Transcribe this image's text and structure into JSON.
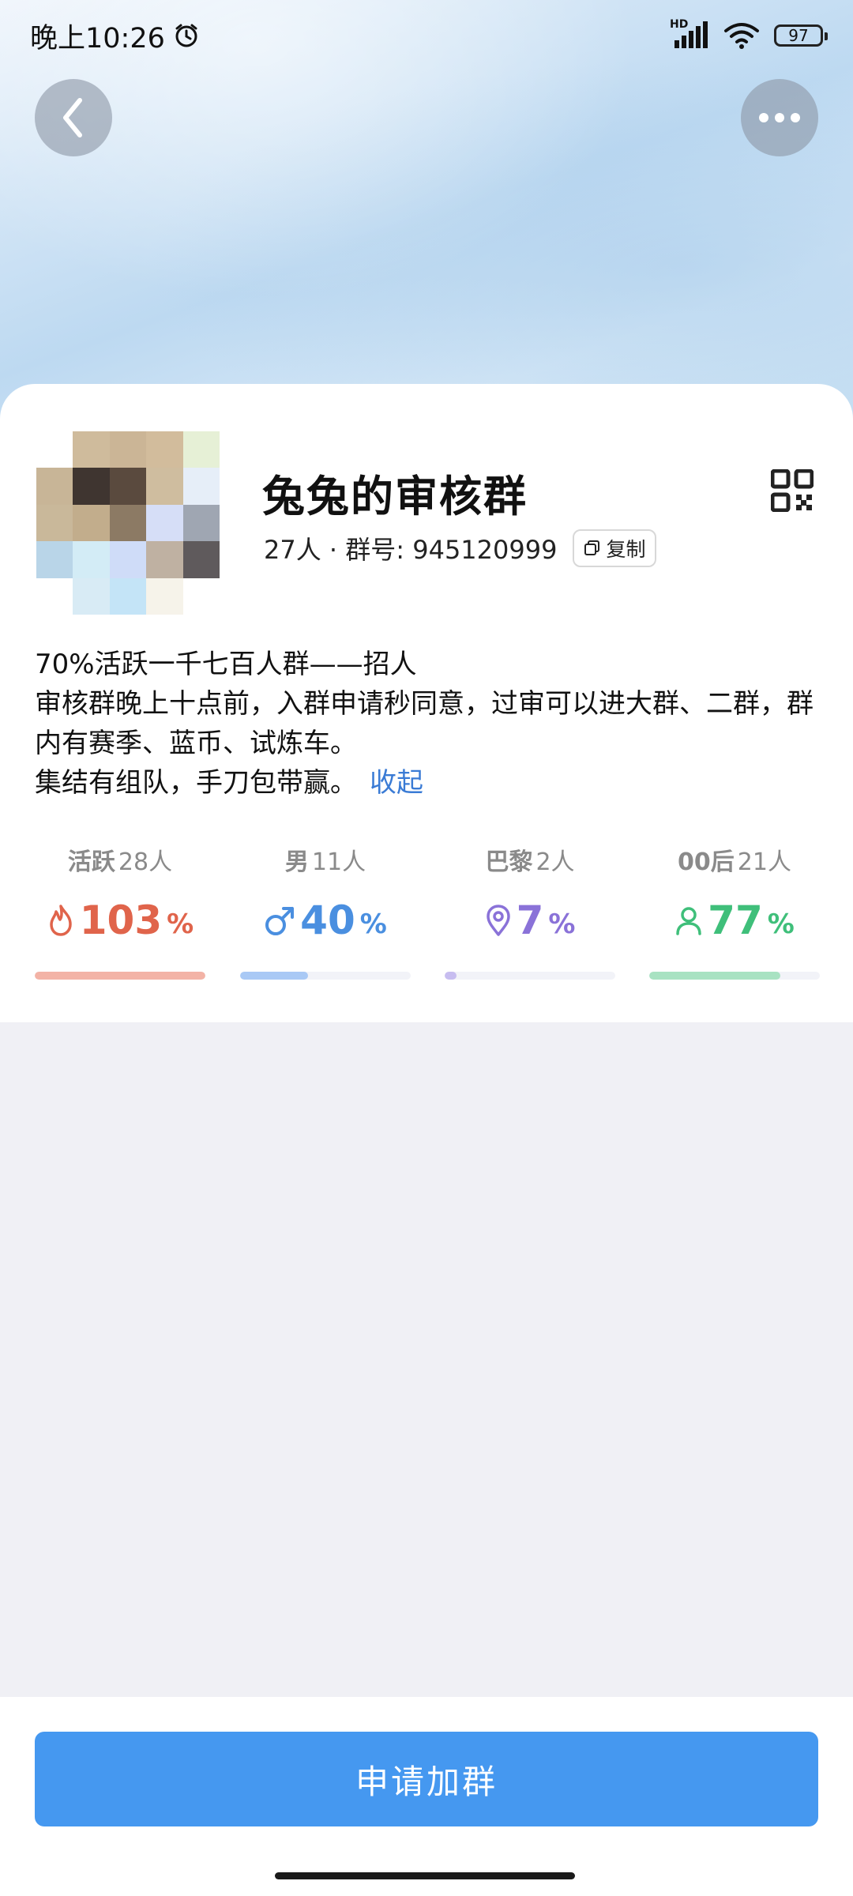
{
  "status_bar": {
    "time": "晚上10:26",
    "network": "HD",
    "battery": "97"
  },
  "header": {
    "back_icon": "chevron-left-icon",
    "more_icon": "more-dots-icon"
  },
  "group": {
    "name": "兔兔的审核群",
    "members": "27人",
    "separator": "·",
    "id_label": "群号:",
    "id_value": "945120999",
    "copy_label": "复制"
  },
  "description": {
    "line1": "70%活跃一千七百人群——招人",
    "line2": "审核群晚上十点前，入群申请秒同意，过审可以进大群、二群，群内有赛季、蓝币、试炼车。",
    "line3": "集结有组队，手刀包带赢。",
    "collapse": "收起"
  },
  "stats": [
    {
      "label": "活跃",
      "count": "28人",
      "value": "103",
      "unit": "%",
      "icon": "flame-icon",
      "color": "#e0644b",
      "bar_color": "#f3b3a6",
      "fill": 1.0
    },
    {
      "label": "男",
      "count": "11人",
      "value": "40",
      "unit": "%",
      "icon": "male-icon",
      "color": "#4a8fe0",
      "bar_color": "#a9c9f5",
      "fill": 0.4
    },
    {
      "label": "巴黎",
      "count": "2人",
      "value": "7",
      "unit": "%",
      "icon": "location-pin-icon",
      "color": "#8a72d8",
      "bar_color": "#c7bdf0",
      "fill": 0.07
    },
    {
      "label": "00后",
      "count": "21人",
      "value": "77",
      "unit": "%",
      "icon": "person-icon",
      "color": "#3fbf7a",
      "bar_color": "#a8e2c2",
      "fill": 0.77
    }
  ],
  "footer": {
    "join_button": "申请加群"
  },
  "colors": {
    "accent": "#4598f0",
    "link": "#3a7bd5"
  }
}
